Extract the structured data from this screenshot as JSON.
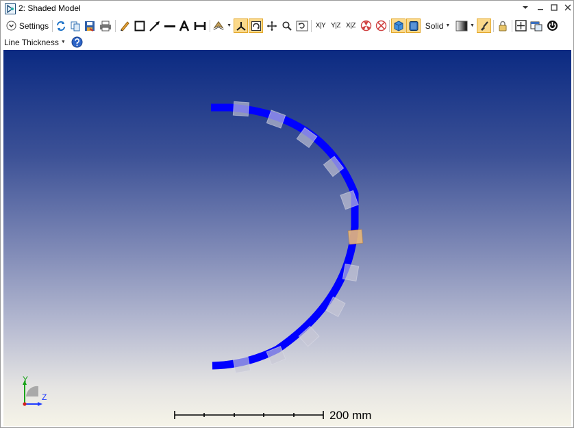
{
  "window": {
    "title": "2: Shaded Model"
  },
  "toolbar": {
    "settings_label": "Settings",
    "axis_xy": "X|Y",
    "axis_yz": "Y|Z",
    "axis_xz": "X|Z",
    "render_mode": "Solid",
    "line_thickness_label": "Line Thickness"
  },
  "icons": [
    "settings-chevron-icon",
    "refresh-icon",
    "copy-icon",
    "save-icon",
    "print-icon",
    "pencil-icon",
    "rectangle-icon",
    "arrow-icon",
    "line-icon",
    "text-icon",
    "dimension-icon",
    "view-rotate-icon",
    "axes-icon",
    "orbit-icon",
    "pan-icon",
    "zoom-icon",
    "reset-view-icon",
    "ray-fan-icon",
    "ray-fan-off-icon",
    "shaded-cube-icon",
    "solid-box-icon",
    "gradient-icon",
    "brush-icon",
    "lock-icon",
    "fit-icon",
    "window-icon",
    "power-icon",
    "help-icon"
  ],
  "viewport": {
    "scale_bar": {
      "label": "200 mm",
      "ticks": 6
    },
    "axes": {
      "y": "Y",
      "z": "Z"
    },
    "colors": {
      "arc": "#0000ff",
      "lens": "#c8c8d6",
      "highlight": "#e8b77a"
    }
  }
}
